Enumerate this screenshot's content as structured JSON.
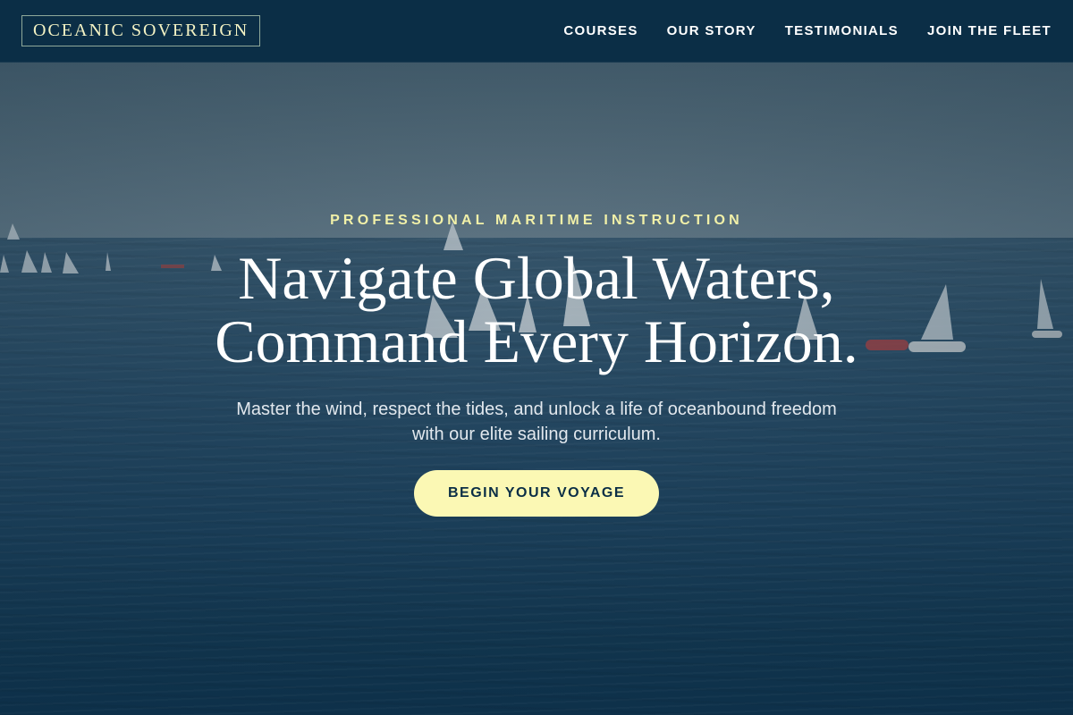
{
  "brand": {
    "name": "OCEANIC SOVEREIGN"
  },
  "nav": {
    "items": [
      {
        "label": "COURSES"
      },
      {
        "label": "OUR STORY"
      },
      {
        "label": "TESTIMONIALS"
      },
      {
        "label": "JOIN THE FLEET"
      }
    ]
  },
  "hero": {
    "eyebrow": "PROFESSIONAL MARITIME INSTRUCTION",
    "headline_line1": "Navigate Global Waters,",
    "headline_line2": "Command Every Horizon.",
    "subtitle": "Master the wind, respect the tides, and unlock a life of oceanbound freedom with our elite sailing curriculum.",
    "cta_label": "BEGIN YOUR VOYAGE"
  },
  "colors": {
    "header_bg": "#0b2e46",
    "accent": "#f1f0a8",
    "cta_bg": "#fbf8b4",
    "text": "#ffffff"
  }
}
